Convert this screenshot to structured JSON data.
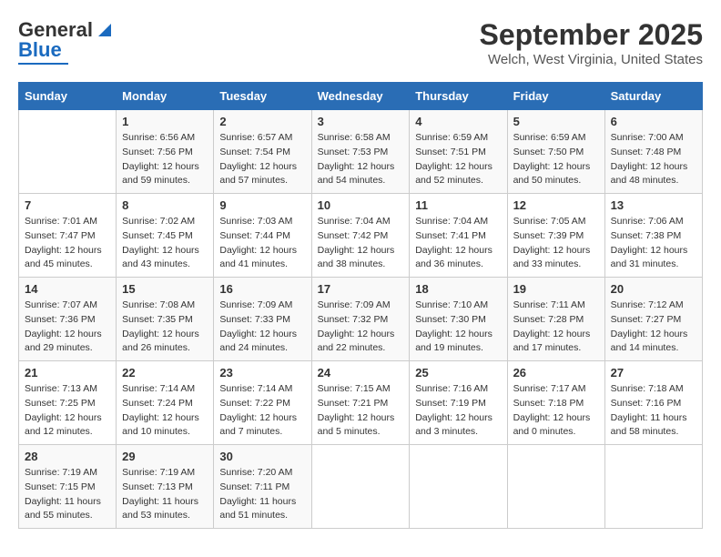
{
  "logo": {
    "text_general": "General",
    "text_blue": "Blue"
  },
  "title": "September 2025",
  "subtitle": "Welch, West Virginia, United States",
  "days_header": [
    "Sunday",
    "Monday",
    "Tuesday",
    "Wednesday",
    "Thursday",
    "Friday",
    "Saturday"
  ],
  "weeks": [
    [
      {
        "day": "",
        "info": ""
      },
      {
        "day": "1",
        "info": "Sunrise: 6:56 AM\nSunset: 7:56 PM\nDaylight: 12 hours\nand 59 minutes."
      },
      {
        "day": "2",
        "info": "Sunrise: 6:57 AM\nSunset: 7:54 PM\nDaylight: 12 hours\nand 57 minutes."
      },
      {
        "day": "3",
        "info": "Sunrise: 6:58 AM\nSunset: 7:53 PM\nDaylight: 12 hours\nand 54 minutes."
      },
      {
        "day": "4",
        "info": "Sunrise: 6:59 AM\nSunset: 7:51 PM\nDaylight: 12 hours\nand 52 minutes."
      },
      {
        "day": "5",
        "info": "Sunrise: 6:59 AM\nSunset: 7:50 PM\nDaylight: 12 hours\nand 50 minutes."
      },
      {
        "day": "6",
        "info": "Sunrise: 7:00 AM\nSunset: 7:48 PM\nDaylight: 12 hours\nand 48 minutes."
      }
    ],
    [
      {
        "day": "7",
        "info": "Sunrise: 7:01 AM\nSunset: 7:47 PM\nDaylight: 12 hours\nand 45 minutes."
      },
      {
        "day": "8",
        "info": "Sunrise: 7:02 AM\nSunset: 7:45 PM\nDaylight: 12 hours\nand 43 minutes."
      },
      {
        "day": "9",
        "info": "Sunrise: 7:03 AM\nSunset: 7:44 PM\nDaylight: 12 hours\nand 41 minutes."
      },
      {
        "day": "10",
        "info": "Sunrise: 7:04 AM\nSunset: 7:42 PM\nDaylight: 12 hours\nand 38 minutes."
      },
      {
        "day": "11",
        "info": "Sunrise: 7:04 AM\nSunset: 7:41 PM\nDaylight: 12 hours\nand 36 minutes."
      },
      {
        "day": "12",
        "info": "Sunrise: 7:05 AM\nSunset: 7:39 PM\nDaylight: 12 hours\nand 33 minutes."
      },
      {
        "day": "13",
        "info": "Sunrise: 7:06 AM\nSunset: 7:38 PM\nDaylight: 12 hours\nand 31 minutes."
      }
    ],
    [
      {
        "day": "14",
        "info": "Sunrise: 7:07 AM\nSunset: 7:36 PM\nDaylight: 12 hours\nand 29 minutes."
      },
      {
        "day": "15",
        "info": "Sunrise: 7:08 AM\nSunset: 7:35 PM\nDaylight: 12 hours\nand 26 minutes."
      },
      {
        "day": "16",
        "info": "Sunrise: 7:09 AM\nSunset: 7:33 PM\nDaylight: 12 hours\nand 24 minutes."
      },
      {
        "day": "17",
        "info": "Sunrise: 7:09 AM\nSunset: 7:32 PM\nDaylight: 12 hours\nand 22 minutes."
      },
      {
        "day": "18",
        "info": "Sunrise: 7:10 AM\nSunset: 7:30 PM\nDaylight: 12 hours\nand 19 minutes."
      },
      {
        "day": "19",
        "info": "Sunrise: 7:11 AM\nSunset: 7:28 PM\nDaylight: 12 hours\nand 17 minutes."
      },
      {
        "day": "20",
        "info": "Sunrise: 7:12 AM\nSunset: 7:27 PM\nDaylight: 12 hours\nand 14 minutes."
      }
    ],
    [
      {
        "day": "21",
        "info": "Sunrise: 7:13 AM\nSunset: 7:25 PM\nDaylight: 12 hours\nand 12 minutes."
      },
      {
        "day": "22",
        "info": "Sunrise: 7:14 AM\nSunset: 7:24 PM\nDaylight: 12 hours\nand 10 minutes."
      },
      {
        "day": "23",
        "info": "Sunrise: 7:14 AM\nSunset: 7:22 PM\nDaylight: 12 hours\nand 7 minutes."
      },
      {
        "day": "24",
        "info": "Sunrise: 7:15 AM\nSunset: 7:21 PM\nDaylight: 12 hours\nand 5 minutes."
      },
      {
        "day": "25",
        "info": "Sunrise: 7:16 AM\nSunset: 7:19 PM\nDaylight: 12 hours\nand 3 minutes."
      },
      {
        "day": "26",
        "info": "Sunrise: 7:17 AM\nSunset: 7:18 PM\nDaylight: 12 hours\nand 0 minutes."
      },
      {
        "day": "27",
        "info": "Sunrise: 7:18 AM\nSunset: 7:16 PM\nDaylight: 11 hours\nand 58 minutes."
      }
    ],
    [
      {
        "day": "28",
        "info": "Sunrise: 7:19 AM\nSunset: 7:15 PM\nDaylight: 11 hours\nand 55 minutes."
      },
      {
        "day": "29",
        "info": "Sunrise: 7:19 AM\nSunset: 7:13 PM\nDaylight: 11 hours\nand 53 minutes."
      },
      {
        "day": "30",
        "info": "Sunrise: 7:20 AM\nSunset: 7:11 PM\nDaylight: 11 hours\nand 51 minutes."
      },
      {
        "day": "",
        "info": ""
      },
      {
        "day": "",
        "info": ""
      },
      {
        "day": "",
        "info": ""
      },
      {
        "day": "",
        "info": ""
      }
    ]
  ]
}
